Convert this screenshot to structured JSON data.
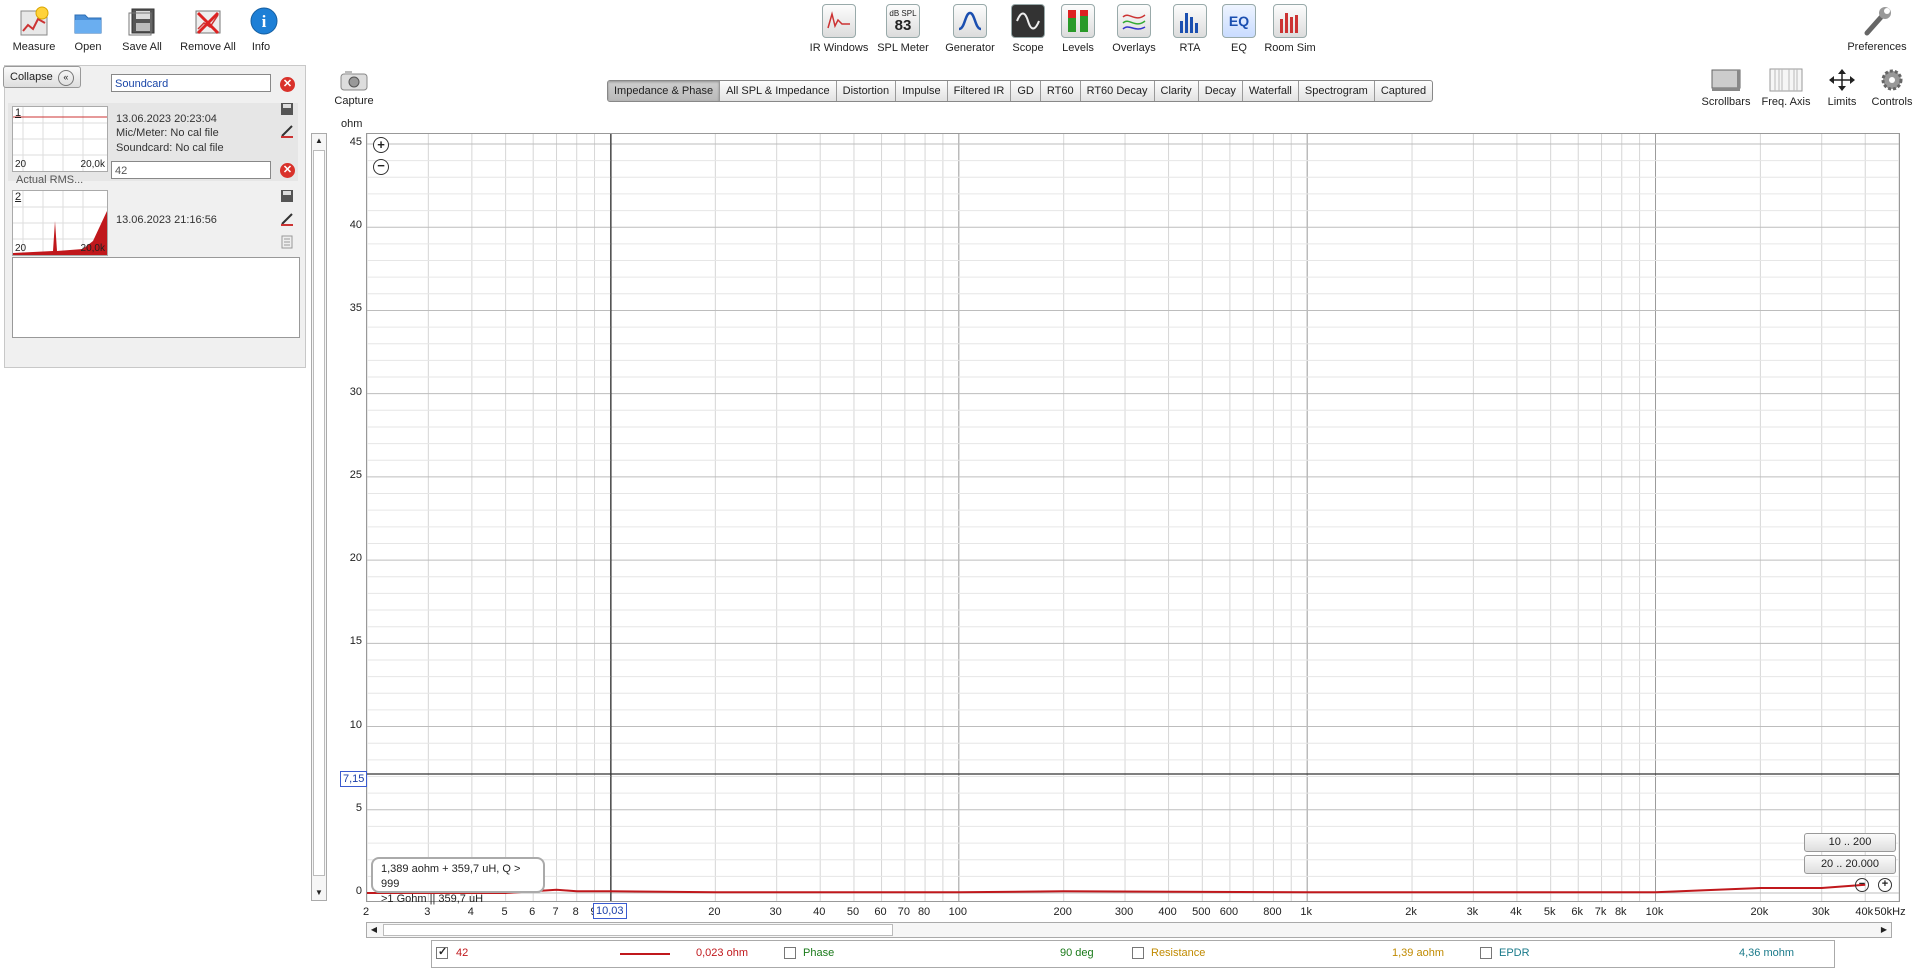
{
  "toolbar_left": [
    {
      "label": "Measure",
      "icon": "measure-icon"
    },
    {
      "label": "Open",
      "icon": "folder-icon"
    },
    {
      "label": "Save All",
      "icon": "save-all-icon"
    },
    {
      "label": "Remove All",
      "icon": "remove-all-icon"
    },
    {
      "label": "Info",
      "icon": "info-icon"
    }
  ],
  "toolbar_mid": [
    {
      "label": "IR Windows",
      "icon": "ir-windows-icon"
    },
    {
      "label": "SPL Meter",
      "icon": "spl-meter-icon",
      "badge_top": "dB SPL",
      "badge_value": "83"
    },
    {
      "label": "Generator",
      "icon": "generator-icon"
    },
    {
      "label": "Scope",
      "icon": "scope-icon"
    },
    {
      "label": "Levels",
      "icon": "levels-icon"
    },
    {
      "label": "Overlays",
      "icon": "overlays-icon"
    },
    {
      "label": "RTA",
      "icon": "rta-icon"
    },
    {
      "label": "EQ",
      "icon": "eq-icon"
    },
    {
      "label": "Room Sim",
      "icon": "room-sim-icon"
    }
  ],
  "preferences_label": "Preferences",
  "collapse_label": "Collapse",
  "measurements": [
    {
      "index": "1",
      "name": "Soundcard",
      "date": "13.06.2023 20:23:04",
      "line2": "Mic/Meter: No cal file",
      "line3": "Soundcard: No cal file",
      "thumb_lo": "20",
      "thumb_hi": "20,0k",
      "extra": "Actual RMS..."
    },
    {
      "index": "2",
      "name": "42",
      "date": "13.06.2023 21:16:56",
      "thumb_lo": "20",
      "thumb_hi": "20,0k"
    }
  ],
  "capture_label": "Capture",
  "tabs": [
    "Impedance & Phase",
    "All SPL & Impedance",
    "Distortion",
    "Impulse",
    "Filtered IR",
    "GD",
    "RT60",
    "RT60 Decay",
    "Clarity",
    "Decay",
    "Waterfall",
    "Spectrogram",
    "Captured"
  ],
  "active_tab": "Impedance & Phase",
  "right_tools": [
    {
      "label": "Scrollbars",
      "icon": "scrollbars-icon"
    },
    {
      "label": "Freq. Axis",
      "icon": "freq-axis-icon"
    },
    {
      "label": "Limits",
      "icon": "limits-icon"
    },
    {
      "label": "Controls",
      "icon": "controls-gear-icon"
    }
  ],
  "chart_data": {
    "type": "line",
    "ylabel": "ohm",
    "ylim": [
      0,
      45
    ],
    "yticks": [
      "45",
      "40",
      "35",
      "30",
      "25",
      "20",
      "15",
      "10",
      "5",
      "0"
    ],
    "xscale": "log",
    "xlim": [
      2,
      50000
    ],
    "xticks": [
      "2",
      "3",
      "4",
      "5",
      "6",
      "7",
      "8",
      "9",
      "20",
      "30",
      "40",
      "50",
      "60",
      "70",
      "80",
      "100",
      "200",
      "300",
      "400",
      "500",
      "600",
      "800",
      "1k",
      "2k",
      "3k",
      "4k",
      "5k",
      "6k",
      "7k",
      "8k",
      "10k",
      "20k",
      "30k",
      "40k",
      "50kHz"
    ],
    "cursor_x_label": "10,03",
    "cursor_y_label": "7,15",
    "cursor_x": 10.03,
    "cursor_y": 7.15,
    "grid": true,
    "series": [
      {
        "name": "42",
        "color": "#c0181c",
        "x": [
          2,
          5,
          6,
          7,
          8,
          10,
          20,
          100,
          200,
          1000,
          10000,
          20000,
          30000,
          40000
        ],
        "values": [
          0.0,
          0.0,
          0.1,
          0.2,
          0.1,
          0.1,
          0.05,
          0.05,
          0.1,
          0.05,
          0.05,
          0.3,
          0.3,
          0.5
        ]
      }
    ]
  },
  "info_box": {
    "line1": "1,389 aohm + 359,7 uH, Q > 999",
    "line2": ">1 Gohm || 359,7 uH"
  },
  "presets": [
    "10 .. 200",
    "20 .. 20.000"
  ],
  "legend": {
    "trace_name": "42",
    "trace_value": "0,023 ohm",
    "phase_label": "Phase",
    "phase_value": "90 deg",
    "resistance_label": "Resistance",
    "resistance_value": "1,39 aohm",
    "epdr_label": "EPDR",
    "epdr_value": "4,36 mohm"
  },
  "colors": {
    "trace": "#c0181c",
    "phase": "#1a7a1a",
    "resistance": "#c08a00",
    "epdr": "#1a7a8a"
  }
}
